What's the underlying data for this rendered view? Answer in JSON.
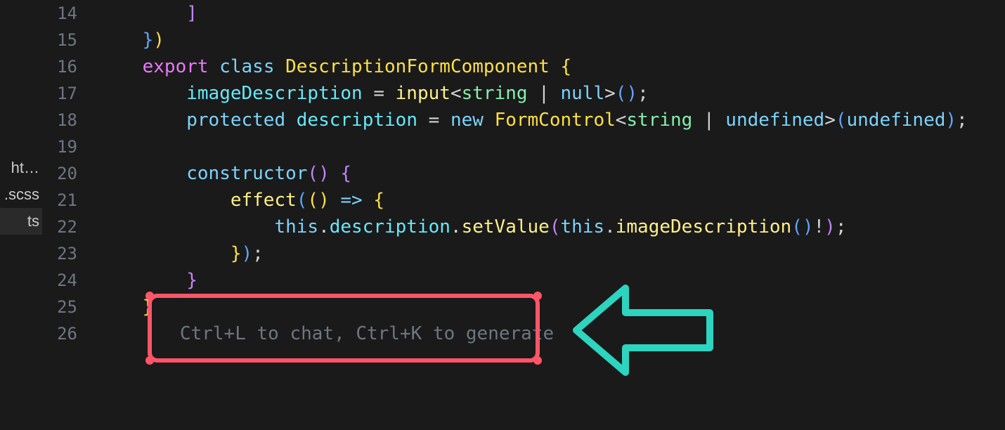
{
  "sidebar": {
    "files": [
      {
        "label": "ht…",
        "active": false
      },
      {
        "label": ".scss",
        "active": false
      },
      {
        "label": "ts",
        "active": true
      }
    ]
  },
  "editor": {
    "lines": [
      {
        "num": 14,
        "tokens": [
          {
            "txt": "        ",
            "cls": ""
          },
          {
            "txt": "]",
            "cls": "tok-brace-purple"
          }
        ]
      },
      {
        "num": 15,
        "tokens": [
          {
            "txt": "    ",
            "cls": ""
          },
          {
            "txt": "}",
            "cls": "tok-brace-blue"
          },
          {
            "txt": ")",
            "cls": "tok-brace-yellow"
          }
        ]
      },
      {
        "num": 16,
        "tokens": [
          {
            "txt": "    ",
            "cls": ""
          },
          {
            "txt": "export",
            "cls": "tok-keyword"
          },
          {
            "txt": " ",
            "cls": ""
          },
          {
            "txt": "class",
            "cls": "tok-keyword2"
          },
          {
            "txt": " ",
            "cls": ""
          },
          {
            "txt": "DescriptionFormComponent",
            "cls": "tok-class"
          },
          {
            "txt": " ",
            "cls": ""
          },
          {
            "txt": "{",
            "cls": "tok-brace-yellow"
          }
        ]
      },
      {
        "num": 17,
        "tokens": [
          {
            "txt": "        ",
            "cls": ""
          },
          {
            "txt": "imageDescription",
            "cls": "tok-prop"
          },
          {
            "txt": " ",
            "cls": ""
          },
          {
            "txt": "=",
            "cls": "tok-operator"
          },
          {
            "txt": " ",
            "cls": ""
          },
          {
            "txt": "input",
            "cls": "tok-func"
          },
          {
            "txt": "<",
            "cls": "tok-punct"
          },
          {
            "txt": "string",
            "cls": "tok-type"
          },
          {
            "txt": " ",
            "cls": ""
          },
          {
            "txt": "|",
            "cls": "tok-operator"
          },
          {
            "txt": " ",
            "cls": ""
          },
          {
            "txt": "null",
            "cls": "tok-undef"
          },
          {
            "txt": ">",
            "cls": "tok-punct"
          },
          {
            "txt": "(",
            "cls": "tok-brace-blue"
          },
          {
            "txt": ")",
            "cls": "tok-brace-blue"
          },
          {
            "txt": ";",
            "cls": "tok-punct"
          }
        ]
      },
      {
        "num": 18,
        "tokens": [
          {
            "txt": "        ",
            "cls": ""
          },
          {
            "txt": "protected",
            "cls": "tok-keyword2"
          },
          {
            "txt": " ",
            "cls": ""
          },
          {
            "txt": "description",
            "cls": "tok-prop"
          },
          {
            "txt": " ",
            "cls": ""
          },
          {
            "txt": "=",
            "cls": "tok-operator"
          },
          {
            "txt": " ",
            "cls": ""
          },
          {
            "txt": "new",
            "cls": "tok-keyword2"
          },
          {
            "txt": " ",
            "cls": ""
          },
          {
            "txt": "FormControl",
            "cls": "tok-class"
          },
          {
            "txt": "<",
            "cls": "tok-punct"
          },
          {
            "txt": "string",
            "cls": "tok-type"
          },
          {
            "txt": " ",
            "cls": ""
          },
          {
            "txt": "|",
            "cls": "tok-operator"
          },
          {
            "txt": " ",
            "cls": ""
          },
          {
            "txt": "undefined",
            "cls": "tok-undef"
          },
          {
            "txt": ">",
            "cls": "tok-punct"
          },
          {
            "txt": "(",
            "cls": "tok-brace-blue"
          },
          {
            "txt": "undefined",
            "cls": "tok-undef"
          },
          {
            "txt": ")",
            "cls": "tok-brace-blue"
          },
          {
            "txt": ";",
            "cls": "tok-punct"
          }
        ]
      },
      {
        "num": 19,
        "tokens": []
      },
      {
        "num": 20,
        "tokens": [
          {
            "txt": "        ",
            "cls": ""
          },
          {
            "txt": "constructor",
            "cls": "tok-keyword2"
          },
          {
            "txt": "(",
            "cls": "tok-brace-purple"
          },
          {
            "txt": ")",
            "cls": "tok-brace-purple"
          },
          {
            "txt": " ",
            "cls": ""
          },
          {
            "txt": "{",
            "cls": "tok-brace-purple"
          }
        ]
      },
      {
        "num": 21,
        "tokens": [
          {
            "txt": "            ",
            "cls": ""
          },
          {
            "txt": "effect",
            "cls": "tok-func"
          },
          {
            "txt": "(",
            "cls": "tok-brace-blue"
          },
          {
            "txt": "(",
            "cls": "tok-brace-yellow"
          },
          {
            "txt": ")",
            "cls": "tok-brace-yellow"
          },
          {
            "txt": " ",
            "cls": ""
          },
          {
            "txt": "=>",
            "cls": "tok-keyword2"
          },
          {
            "txt": " ",
            "cls": ""
          },
          {
            "txt": "{",
            "cls": "tok-brace-yellow"
          }
        ]
      },
      {
        "num": 22,
        "tokens": [
          {
            "txt": "                ",
            "cls": ""
          },
          {
            "txt": "this",
            "cls": "tok-this"
          },
          {
            "txt": ".",
            "cls": "tok-punct"
          },
          {
            "txt": "description",
            "cls": "tok-prop"
          },
          {
            "txt": ".",
            "cls": "tok-punct"
          },
          {
            "txt": "setValue",
            "cls": "tok-method"
          },
          {
            "txt": "(",
            "cls": "tok-brace-purple"
          },
          {
            "txt": "this",
            "cls": "tok-this"
          },
          {
            "txt": ".",
            "cls": "tok-punct"
          },
          {
            "txt": "imageDescription",
            "cls": "tok-method"
          },
          {
            "txt": "(",
            "cls": "tok-brace-blue"
          },
          {
            "txt": ")",
            "cls": "tok-brace-blue"
          },
          {
            "txt": "!",
            "cls": "tok-operator"
          },
          {
            "txt": ")",
            "cls": "tok-brace-purple"
          },
          {
            "txt": ";",
            "cls": "tok-punct"
          }
        ]
      },
      {
        "num": 23,
        "tokens": [
          {
            "txt": "            ",
            "cls": ""
          },
          {
            "txt": "}",
            "cls": "tok-brace-yellow"
          },
          {
            "txt": ")",
            "cls": "tok-brace-blue"
          },
          {
            "txt": ";",
            "cls": "tok-punct"
          }
        ]
      },
      {
        "num": 24,
        "tokens": [
          {
            "txt": "        ",
            "cls": ""
          },
          {
            "txt": "}",
            "cls": "tok-brace-purple"
          }
        ]
      },
      {
        "num": 25,
        "tokens": [
          {
            "txt": "    ",
            "cls": ""
          },
          {
            "txt": "}",
            "cls": "tok-brace-yellow"
          }
        ]
      }
    ],
    "cursor_line_num": 26,
    "placeholder": "Ctrl+L to chat, Ctrl+K to generate"
  },
  "annotation": {
    "box_color": "#ff5569",
    "arrow_color": "#2dd4bf"
  }
}
